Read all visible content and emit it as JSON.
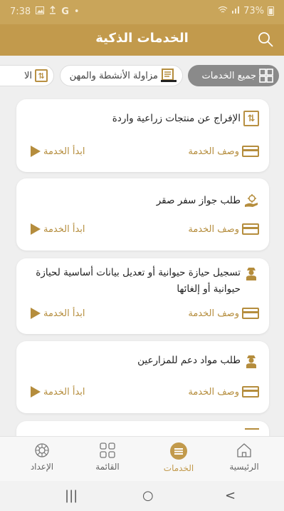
{
  "status_bar": {
    "time": "7:38",
    "battery": "73%",
    "left_icons": [
      "gallery-icon",
      "upload-icon",
      "google-icon",
      "dot-icon"
    ],
    "right_icons": [
      "wifi-icon",
      "signal-icon",
      "battery-icon"
    ]
  },
  "header": {
    "title": "الخدمات الذكية",
    "search_icon": "search-icon"
  },
  "filters": [
    {
      "label": "جميع الخدمات",
      "icon": "grid-icon",
      "active": true
    },
    {
      "label": "مزاولة الأنشطة والمهن",
      "icon": "license-icon",
      "active": false
    },
    {
      "label": "الا",
      "icon": "exchange-icon",
      "active": false
    }
  ],
  "services": [
    {
      "title": "الإفراج عن منتجات زراعية واردة",
      "icon": "exchange-icon",
      "desc_label": "وصف الخدمة",
      "start_label": "ابدأ الخدمة"
    },
    {
      "title": "طلب جواز سفر صقر",
      "icon": "falcon-hand-icon",
      "desc_label": "وصف الخدمة",
      "start_label": "ابدأ الخدمة"
    },
    {
      "title": "تسجيل حيازة حيوانية أو تعديل بيانات أساسية لحيازة حيوانية أو إلغائها",
      "icon": "farmer-icon",
      "desc_label": "وصف الخدمة",
      "start_label": "ابدأ الخدمة"
    },
    {
      "title": "طلب مواد دعم للمزارعين",
      "icon": "farmer-icon",
      "desc_label": "وصف الخدمة",
      "start_label": "ابدأ الخدمة"
    }
  ],
  "bottom_nav": [
    {
      "label": "الإعداد",
      "icon": "settings-icon"
    },
    {
      "label": "القائمة",
      "icon": "menu-grid-icon"
    },
    {
      "label": "الخدمات",
      "icon": "services-icon",
      "active": true
    },
    {
      "label": "الرئيسية",
      "icon": "home-icon"
    }
  ],
  "system_nav": {
    "recent": "|||",
    "home": "○",
    "back": "<"
  },
  "colors": {
    "brand": "#c29a4c",
    "accent": "#b58d3d",
    "status_bar": "#c9a55a"
  }
}
